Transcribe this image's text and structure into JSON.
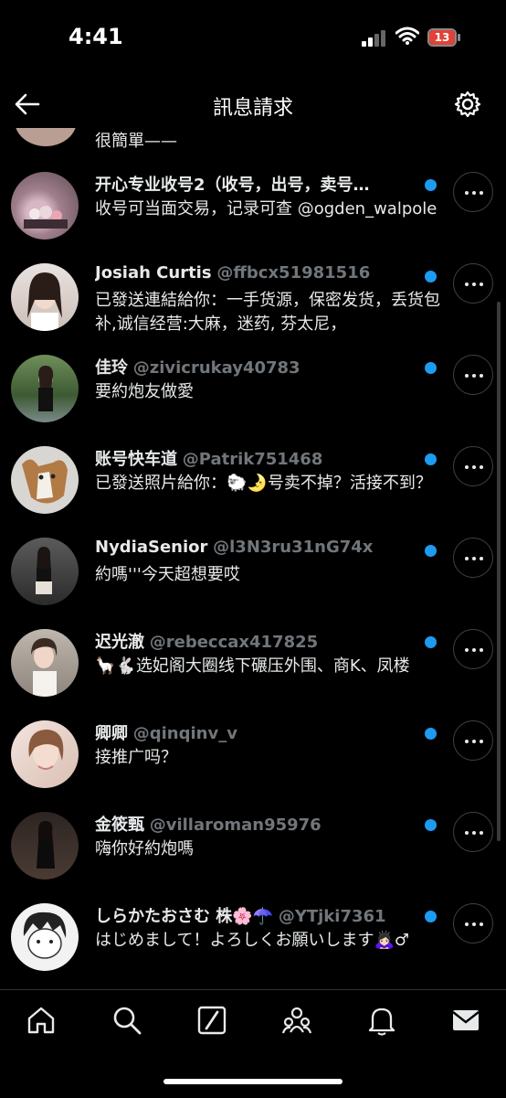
{
  "status_bar": {
    "time": "4:41",
    "battery": "13"
  },
  "header": {
    "title": "訊息請求"
  },
  "partial_row": {
    "preview": "很簡單——"
  },
  "requests": [
    {
      "name": "开心专业收号2（收号，出号，卖号…",
      "handle": "",
      "preview": "收号可当面交易，记录可查 @ogden_walpole",
      "unread": true
    },
    {
      "name": "Josiah Curtis",
      "handle": "@ffbcx51981516",
      "preview": "已發送連結給你：一手货源，保密发货，丢货包补,诚信经营:大麻，迷药, 芬太尼，",
      "unread": true
    },
    {
      "name": "佳玲",
      "handle": "@zivicrukay40783",
      "preview": "要約炮友做愛",
      "unread": true
    },
    {
      "name": "账号快车道",
      "handle": "@Patrik751468",
      "preview": "已發送照片給你：🐑🌛号卖不掉？活接不到？",
      "unread": true
    },
    {
      "name": "NydiaSenior",
      "handle": "@l3N3ru31nG74x",
      "preview": "約嗎'''今天超想要哎",
      "unread": true
    },
    {
      "name": "迟光澈",
      "handle": "@rebeccax417825",
      "preview": "🦙🐇选妃阁大圈线下碾压外围、商K、凤楼",
      "unread": true
    },
    {
      "name": "卿卿",
      "handle": "@qinqinv_v",
      "preview": "接推广吗？",
      "unread": true
    },
    {
      "name": "金筱甄",
      "handle": "@villaroman95976",
      "preview": "嗨你好約炮嗎",
      "unread": true
    },
    {
      "name": "しらかたおさむ 株🌸☂️",
      "handle": "@YTjki7361",
      "preview": "はじめまして！よろしくお願いします🙇🏻‍♀️♂",
      "unread": true
    }
  ],
  "colors": {
    "accent": "#1d9bf0",
    "background": "#000000",
    "muted": "#71767b",
    "battery": "#e0423a"
  },
  "nav": [
    "home-icon",
    "search-icon",
    "grok-icon",
    "communities-icon",
    "notifications-icon",
    "messages-icon"
  ]
}
